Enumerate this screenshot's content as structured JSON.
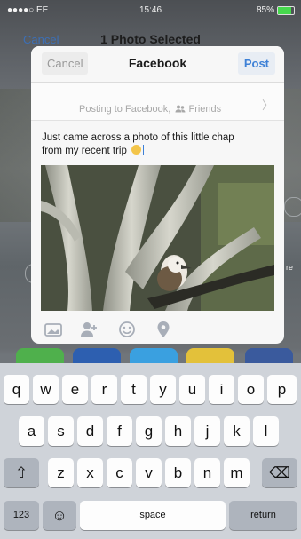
{
  "status_bar": {
    "carrier": "●●●●○ EE",
    "time": "15:46",
    "battery": "85%"
  },
  "background": {
    "cancel_label": "Cancel",
    "title": "1 Photo Selected",
    "side_label": "re"
  },
  "sheet": {
    "cancel_label": "Cancel",
    "title": "Facebook",
    "post_label": "Post",
    "posting_to": "Posting to Facebook,",
    "audience": "Friends",
    "audience_icon": "friends-icon",
    "message_line1": "Just came across a photo of this little chap",
    "message_line2": "from my recent trip",
    "message_emoji": "grinning-face-emoji"
  },
  "toolbar": {
    "icons": [
      "photo-icon",
      "tag-friends-icon",
      "feeling-icon",
      "location-icon"
    ]
  },
  "keyboard": {
    "row1": [
      "q",
      "w",
      "e",
      "r",
      "t",
      "y",
      "u",
      "i",
      "o",
      "p"
    ],
    "row2": [
      "a",
      "s",
      "d",
      "f",
      "g",
      "h",
      "j",
      "k",
      "l"
    ],
    "row3": [
      "z",
      "x",
      "c",
      "v",
      "b",
      "n",
      "m"
    ],
    "shift_label": "⇧",
    "delete_label": "⌫",
    "numbers_label": "123",
    "emoji_label": "☺",
    "space_label": "space",
    "return_label": "return"
  },
  "colors": {
    "accent": "#3d80d6",
    "keyboard_bg": "#cfd3d9",
    "battery": "#46d84d"
  }
}
